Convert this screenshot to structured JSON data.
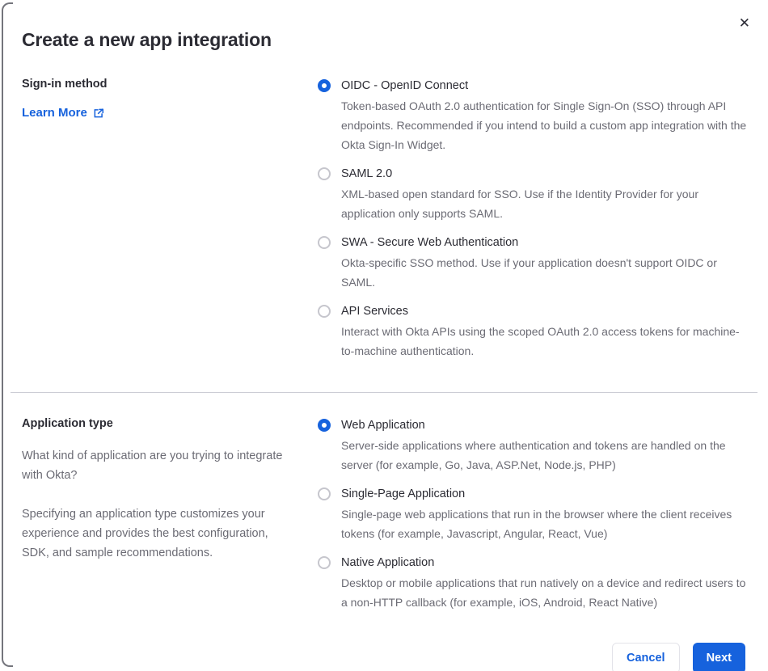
{
  "modal": {
    "title": "Create a new app integration",
    "close_icon": "✕"
  },
  "signin_section": {
    "label": "Sign-in method",
    "learn_more_label": "Learn More",
    "options": [
      {
        "label": "OIDC - OpenID Connect",
        "description": "Token-based OAuth 2.0 authentication for Single Sign-On (SSO) through API endpoints. Recommended if you intend to build a custom app integration with the Okta Sign-In Widget.",
        "selected": true
      },
      {
        "label": "SAML 2.0",
        "description": "XML-based open standard for SSO. Use if the Identity Provider for your application only supports SAML.",
        "selected": false
      },
      {
        "label": "SWA - Secure Web Authentication",
        "description": "Okta-specific SSO method. Use if your application doesn't support OIDC or SAML.",
        "selected": false
      },
      {
        "label": "API Services",
        "description": "Interact with Okta APIs using the scoped OAuth 2.0 access tokens for machine-to-machine authentication.",
        "selected": false
      }
    ]
  },
  "apptype_section": {
    "label": "Application type",
    "paragraph_1": "What kind of application are you trying to integrate with Okta?",
    "paragraph_2": "Specifying an application type customizes your experience and provides the best configuration, SDK, and sample recommendations.",
    "options": [
      {
        "label": "Web Application",
        "description": "Server-side applications where authentication and tokens are handled on the server (for example, Go, Java, ASP.Net, Node.js, PHP)",
        "selected": true
      },
      {
        "label": "Single-Page Application",
        "description": "Single-page web applications that run in the browser where the client receives tokens (for example, Javascript, Angular, React, Vue)",
        "selected": false
      },
      {
        "label": "Native Application",
        "description": "Desktop or mobile applications that run natively on a device and redirect users to a non-HTTP callback (for example, iOS, Android, React Native)",
        "selected": false
      }
    ]
  },
  "footer": {
    "cancel_label": "Cancel",
    "next_label": "Next"
  },
  "colors": {
    "accent_blue": "#1662dd",
    "text_dark": "#2b2b33",
    "text_gray": "#6b6b74",
    "divider": "#cccdd5"
  }
}
